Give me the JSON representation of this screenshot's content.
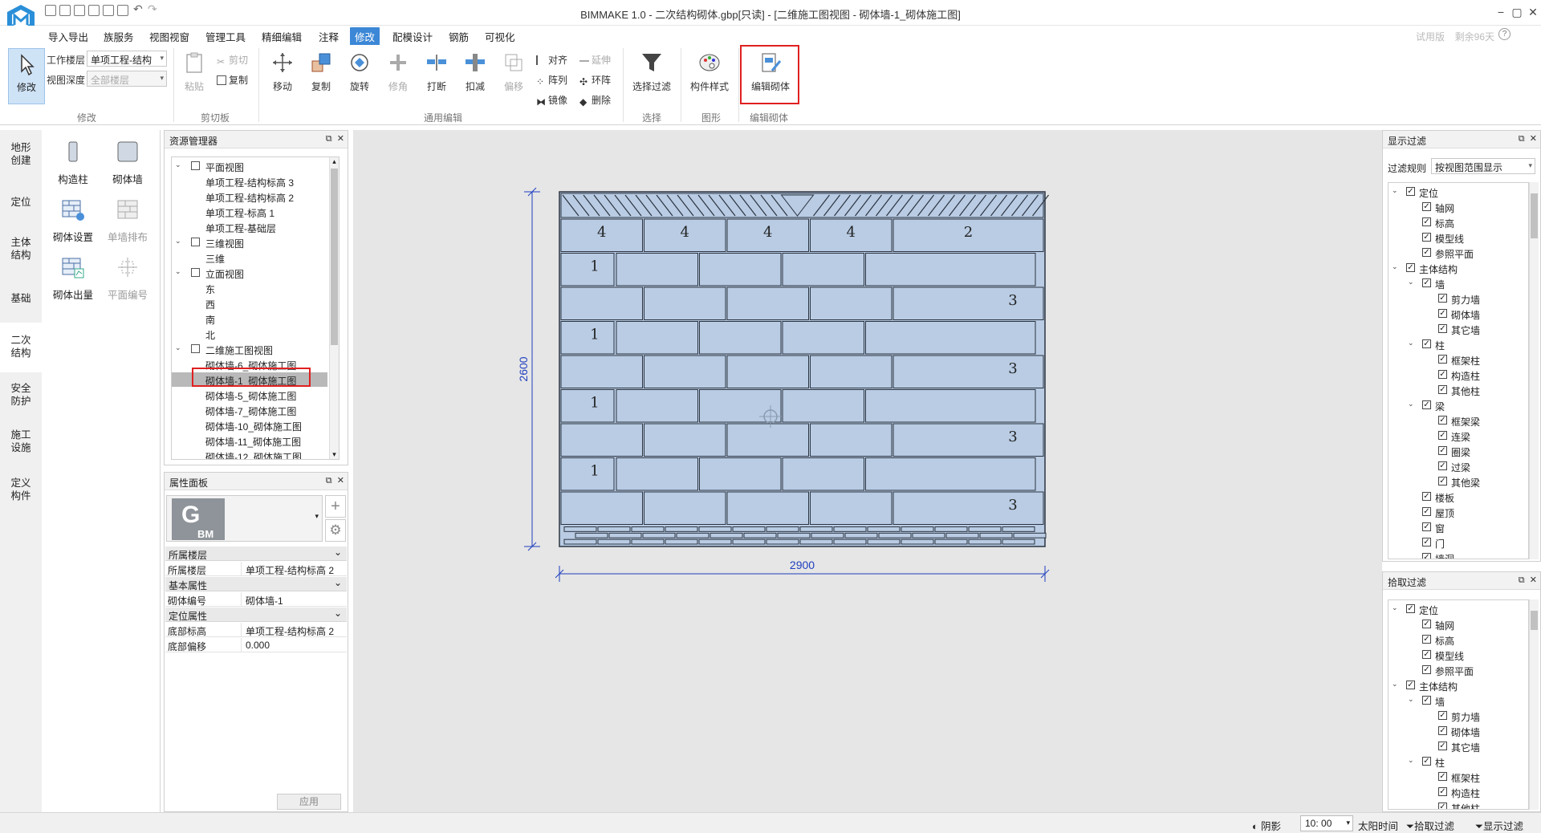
{
  "titlebar": {
    "title": "BIMMAKE 1.0 - 二次结构砌体.gbp[只读] - [二维施工图视图 - 砌体墙-1_砌体施工图]",
    "minimize": "−",
    "restore": "▢",
    "close": "✕"
  },
  "menu": {
    "tabs": [
      "导入导出",
      "族服务",
      "视图视窗",
      "管理工具",
      "精细编辑",
      "注释",
      "修改",
      "配模设计",
      "钢筋",
      "可视化"
    ],
    "active": "修改",
    "trial_label": "试用版",
    "trial_days": "剩余96天",
    "help": "?"
  },
  "ribbon": {
    "modify_label": "修改",
    "work_floor_label": "工作楼层",
    "work_floor_value": "单项工程-结构",
    "view_depth_label": "视图深度",
    "view_depth_value": "全部楼层",
    "group_modify": "修改",
    "paste": "粘贴",
    "cut": "剪切",
    "copy_small": "复制",
    "group_clipboard": "剪切板",
    "move": "移动",
    "copy": "复制",
    "rotate": "旋转",
    "trim": "修角",
    "break": "打断",
    "deduct": "扣减",
    "offset": "偏移",
    "align": "对齐",
    "extend": "延伸",
    "array": "阵列",
    "ring": "环阵",
    "mirror": "镜像",
    "delete": "删除",
    "group_edit": "通用编辑",
    "select_filter": "选择过滤",
    "group_select": "选择",
    "component_style": "构件样式",
    "group_graphic": "图形",
    "edit_masonry": "编辑砌体",
    "group_edit_masonry": "编辑砌体"
  },
  "leftnav": {
    "items": [
      "地形\n创建",
      "定位",
      "主体\n结构",
      "基础",
      "二次\n结构",
      "安全\n防护",
      "施工\n设施",
      "定义\n构件"
    ],
    "active_index": 4
  },
  "palette": {
    "items": [
      {
        "label": "构造柱",
        "enabled": true
      },
      {
        "label": "砌体墙",
        "enabled": true
      },
      {
        "label": "砌体设置",
        "enabled": true
      },
      {
        "label": "单墙排布",
        "enabled": false
      },
      {
        "label": "砌体出量",
        "enabled": true
      },
      {
        "label": "平面编号",
        "enabled": false
      }
    ]
  },
  "resource_manager": {
    "title": "资源管理器",
    "tree": [
      {
        "level": 0,
        "label": "平面视图",
        "toggle": "⌄"
      },
      {
        "level": 1,
        "label": "单项工程-结构标高 3"
      },
      {
        "level": 1,
        "label": "单项工程-结构标高 2"
      },
      {
        "level": 1,
        "label": "单项工程-标高 1"
      },
      {
        "level": 1,
        "label": "单项工程-基础层"
      },
      {
        "level": 0,
        "label": "三维视图",
        "toggle": "⌄"
      },
      {
        "level": 1,
        "label": "三维"
      },
      {
        "level": 0,
        "label": "立面视图",
        "toggle": "⌄"
      },
      {
        "level": 1,
        "label": "东"
      },
      {
        "level": 1,
        "label": "西"
      },
      {
        "level": 1,
        "label": "南"
      },
      {
        "level": 1,
        "label": "北"
      },
      {
        "level": 0,
        "label": "二维施工图视图",
        "toggle": "⌄"
      },
      {
        "level": 1,
        "label": "砌体墙-6_砌体施工图"
      },
      {
        "level": 1,
        "label": "砌体墙-1_砌体施工图",
        "selected": true
      },
      {
        "level": 1,
        "label": "砌体墙-5_砌体施工图"
      },
      {
        "level": 1,
        "label": "砌体墙-7_砌体施工图"
      },
      {
        "level": 1,
        "label": "砌体墙-10_砌体施工图"
      },
      {
        "level": 1,
        "label": "砌体墙-11_砌体施工图"
      },
      {
        "level": 1,
        "label": "砌体墙-12_砌体施工图"
      }
    ]
  },
  "properties": {
    "title": "属性面板",
    "logo_text": "BM",
    "sections": [
      {
        "name": "所属楼层",
        "rows": [
          {
            "key": "所属楼层",
            "value": "单项工程-结构标高 2"
          }
        ]
      },
      {
        "name": "基本属性",
        "rows": [
          {
            "key": "砌体编号",
            "value": "砌体墙-1"
          }
        ]
      },
      {
        "name": "定位属性",
        "rows": [
          {
            "key": "底部标高",
            "value": "单项工程-结构标高 2"
          },
          {
            "key": "底部偏移",
            "value": "0.000"
          }
        ]
      }
    ],
    "apply": "应用"
  },
  "drawing": {
    "width_dim": "2900",
    "height_dim": "2600",
    "top_row_numbers": [
      "4",
      "4",
      "4",
      "4",
      "2"
    ],
    "left_numbers": [
      "1",
      "1",
      "1",
      "1"
    ],
    "right_numbers": [
      "3",
      "3",
      "3",
      "3"
    ],
    "fill_color": "#b9cce4",
    "line_color": "#2b3340",
    "dim_color": "#1f3fbf"
  },
  "display_filter": {
    "title": "显示过滤",
    "rule_label": "过滤规则",
    "rule_value": "按视图范围显示",
    "items": [
      {
        "level": 0,
        "label": "定位",
        "toggle": true
      },
      {
        "level": 1,
        "label": "轴网"
      },
      {
        "level": 1,
        "label": "标高"
      },
      {
        "level": 1,
        "label": "模型线"
      },
      {
        "level": 1,
        "label": "参照平面"
      },
      {
        "level": 0,
        "label": "主体结构",
        "toggle": true
      },
      {
        "level": 1,
        "label": "墙",
        "toggle": true
      },
      {
        "level": 2,
        "label": "剪力墙"
      },
      {
        "level": 2,
        "label": "砌体墙"
      },
      {
        "level": 2,
        "label": "其它墙"
      },
      {
        "level": 1,
        "label": "柱",
        "toggle": true
      },
      {
        "level": 2,
        "label": "框架柱"
      },
      {
        "level": 2,
        "label": "构造柱"
      },
      {
        "level": 2,
        "label": "其他柱"
      },
      {
        "level": 1,
        "label": "梁",
        "toggle": true
      },
      {
        "level": 2,
        "label": "框架梁"
      },
      {
        "level": 2,
        "label": "连梁"
      },
      {
        "level": 2,
        "label": "圈梁"
      },
      {
        "level": 2,
        "label": "过梁"
      },
      {
        "level": 2,
        "label": "其他梁"
      },
      {
        "level": 1,
        "label": "楼板"
      },
      {
        "level": 1,
        "label": "屋顶"
      },
      {
        "level": 1,
        "label": "窗"
      },
      {
        "level": 1,
        "label": "门"
      },
      {
        "level": 1,
        "label": "墙洞"
      }
    ]
  },
  "pick_filter": {
    "title": "拾取过滤",
    "items": [
      {
        "level": 0,
        "label": "定位",
        "toggle": true
      },
      {
        "level": 1,
        "label": "轴网"
      },
      {
        "level": 1,
        "label": "标高"
      },
      {
        "level": 1,
        "label": "模型线"
      },
      {
        "level": 1,
        "label": "参照平面"
      },
      {
        "level": 0,
        "label": "主体结构",
        "toggle": true
      },
      {
        "level": 1,
        "label": "墙",
        "toggle": true
      },
      {
        "level": 2,
        "label": "剪力墙"
      },
      {
        "level": 2,
        "label": "砌体墙"
      },
      {
        "level": 2,
        "label": "其它墙"
      },
      {
        "level": 1,
        "label": "柱",
        "toggle": true
      },
      {
        "level": 2,
        "label": "框架柱"
      },
      {
        "level": 2,
        "label": "构造柱"
      },
      {
        "level": 2,
        "label": "其他柱"
      }
    ]
  },
  "statusbar": {
    "shadow": "阴影",
    "time": "10: 00",
    "sun_time": "太阳时间",
    "pick_filter": "拾取过滤",
    "display_filter": "显示过滤"
  }
}
